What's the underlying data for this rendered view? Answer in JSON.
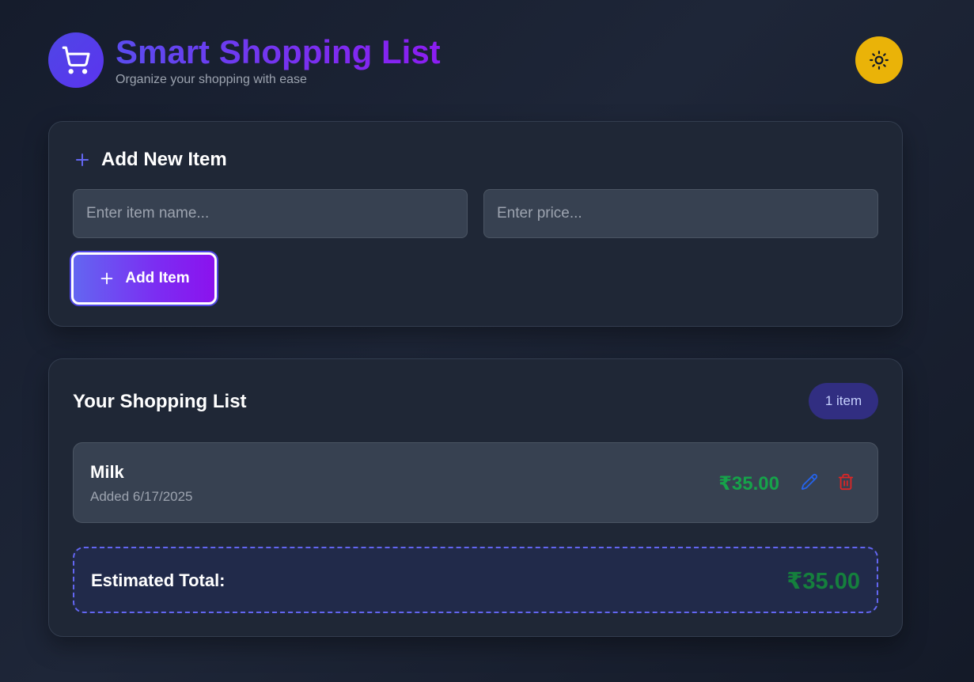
{
  "header": {
    "title": "Smart Shopping List",
    "subtitle": "Organize your shopping with ease",
    "logo_icon": "shopping-cart-icon",
    "theme_toggle_icon": "sun-icon"
  },
  "add_form": {
    "title": "Add New Item",
    "title_icon": "plus-icon",
    "name_value": "",
    "name_placeholder": "Enter item name...",
    "price_value": "",
    "price_placeholder": "Enter price...",
    "add_button_label": "Add Item"
  },
  "list": {
    "title": "Your Shopping List",
    "count_badge": "1 item",
    "items": [
      {
        "name": "Milk",
        "added": "Added 6/17/2025",
        "price": "₹35.00",
        "edit_icon": "pencil-icon",
        "delete_icon": "trash-icon"
      }
    ],
    "total_label": "Estimated Total:",
    "total_value": "₹35.00"
  },
  "colors": {
    "accent": "#6366f1",
    "title_gradient_end": "#8c1df2",
    "price_green": "#16a34a",
    "theme_button": "#eab308",
    "delete_red": "#dc2626",
    "edit_blue": "#2563eb"
  }
}
